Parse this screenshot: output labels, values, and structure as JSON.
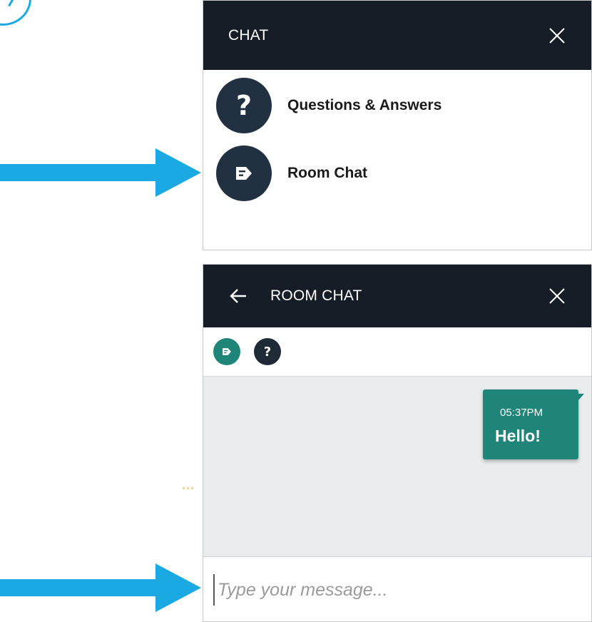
{
  "top_panel": {
    "title": "CHAT",
    "items": [
      {
        "label": "Questions & Answers",
        "icon": "question-icon"
      },
      {
        "label": "Room Chat",
        "icon": "chat-note-icon"
      }
    ]
  },
  "bottom_panel": {
    "title": "ROOM CHAT",
    "tabs": [
      {
        "icon": "chat-note-icon",
        "color": "#1f8578"
      },
      {
        "icon": "question-icon",
        "color": "#1e2a36"
      }
    ],
    "messages": [
      {
        "time": "05:37PM",
        "text": "Hello!"
      }
    ],
    "composer": {
      "placeholder": "Type your message..."
    }
  },
  "colors": {
    "header_bg": "#161d27",
    "accent_teal": "#1f8578",
    "icon_circle": "#223141",
    "annotation_arrow": "#1aa9e2",
    "messages_bg": "#e9ecec"
  }
}
